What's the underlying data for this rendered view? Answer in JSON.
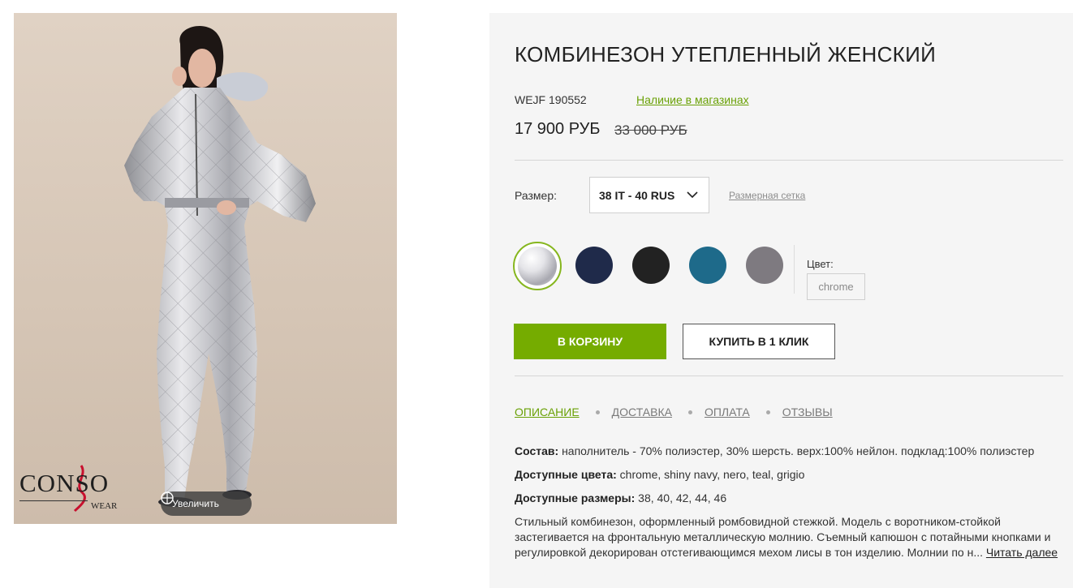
{
  "image": {
    "brand_logo": "CONSO",
    "brand_logo_sub": "WEAR",
    "zoom_label": "Увеличить",
    "zoom_icon": "plus-circle-icon"
  },
  "product": {
    "title": "КОМБИНЕЗОН УТЕПЛЕННЫЙ ЖЕНСКИЙ",
    "sku": "WEJF 190552",
    "stock_link": "Наличие в магазинах",
    "price": "17 900 РУБ",
    "old_price": "33 000 РУБ"
  },
  "size": {
    "label": "Размер:",
    "selected": "38 IT - 40 RUS",
    "grid_link": "Размерная сетка"
  },
  "colors": {
    "label": "Цвет:",
    "selected_name": "chrome",
    "swatches": [
      {
        "name": "chrome",
        "color": "#d8d8dc"
      },
      {
        "name": "shiny navy",
        "color": "#1f2a4a"
      },
      {
        "name": "nero",
        "color": "#222222"
      },
      {
        "name": "teal",
        "color": "#1e6a8a"
      },
      {
        "name": "grigio",
        "color": "#7e7a80"
      }
    ]
  },
  "buttons": {
    "cart": "В КОРЗИНУ",
    "one_click": "КУПИТЬ В 1 КЛИК"
  },
  "tabs": [
    "ОПИСАНИЕ",
    "ДОСТАВКА",
    "ОПЛАТА",
    "ОТЗЫВЫ"
  ],
  "details": {
    "composition_label": "Состав:",
    "composition_value": " наполнитель - 70% полиэстер, 30% шерсть. верх:100% нейлон. подклад:100% полиэстер",
    "colors_label": "Доступные цвета:",
    "colors_value": " chrome, shiny navy, nero, teal, grigio",
    "sizes_label": "Доступные размеры:",
    "sizes_value": " 38, 40, 42, 44, 46",
    "text": "Стильный комбинезон, оформленный ромбовидной стежкой. Модель с воротником-стойкой застегивается на фронтальную металлическую молнию. Съемный капюшон с потайными кнопками и регулировкой декорирован отстегивающимся мехом лисы в тон изделию. Молнии по н...",
    "read_more": "Читать далее"
  },
  "accent_color": "#75ac00"
}
